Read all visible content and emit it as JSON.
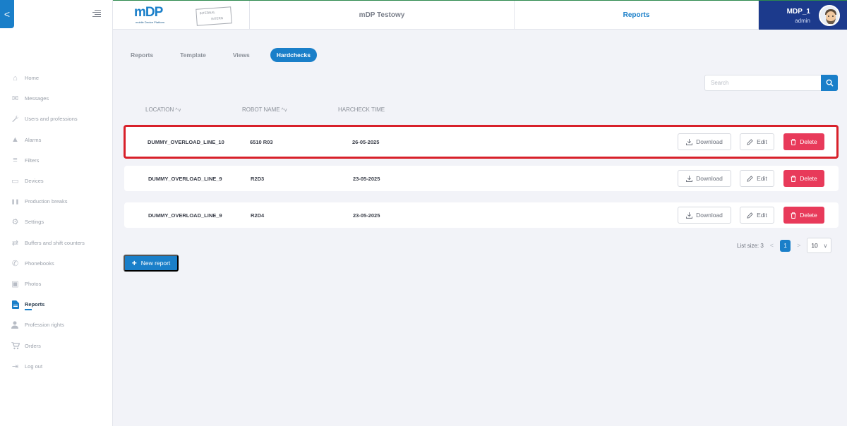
{
  "sidebar": {
    "collapse_glyph": "<",
    "items": [
      {
        "label": "Home",
        "icon": "home-icon",
        "glyph": "⌂"
      },
      {
        "label": "Messages",
        "icon": "mail-icon",
        "glyph": "✉"
      },
      {
        "label": "Users and professions",
        "icon": "wrench-icon",
        "glyph": "🔧"
      },
      {
        "label": "Alarms",
        "icon": "warning-icon",
        "glyph": "▲"
      },
      {
        "label": "Filters",
        "icon": "filter-icon",
        "glyph": "≡"
      },
      {
        "label": "Devices",
        "icon": "devices-icon",
        "glyph": "▭"
      },
      {
        "label": "Production breaks",
        "icon": "pause-icon",
        "glyph": "❚❚"
      },
      {
        "label": "Settings",
        "icon": "gear-icon",
        "glyph": "⚙"
      },
      {
        "label": "Buffers and shift counters",
        "icon": "transfer-icon",
        "glyph": "⇄"
      },
      {
        "label": "Phonebooks",
        "icon": "phone-icon",
        "glyph": "✆"
      },
      {
        "label": "Photos",
        "icon": "image-icon",
        "glyph": "▣"
      },
      {
        "label": "Reports",
        "icon": "document-icon",
        "glyph": "▤",
        "active": true
      },
      {
        "label": "Profession rights",
        "icon": "user-key-icon",
        "glyph": "👤"
      },
      {
        "label": "Orders",
        "icon": "cart-icon",
        "glyph": "🛒"
      },
      {
        "label": "Log out",
        "icon": "logout-icon",
        "glyph": "⇥"
      }
    ]
  },
  "header": {
    "logo_text": "mDP",
    "logo_subtitle": "mobile Device Platform",
    "stamp_line1": "INTERNAL",
    "stamp_line2": "INTERN",
    "app_name": "mDP Testowy",
    "section": "Reports",
    "user_name": "MDP_1",
    "user_role": "admin"
  },
  "tabs": [
    {
      "label": "Reports",
      "active": false
    },
    {
      "label": "Template",
      "active": false
    },
    {
      "label": "Views",
      "active": false
    },
    {
      "label": "Hardchecks",
      "active": true
    }
  ],
  "search": {
    "placeholder": "Search",
    "value": ""
  },
  "table": {
    "columns": [
      {
        "label": "LOCATION",
        "sortable": true,
        "sort_glyph": "^v"
      },
      {
        "label": "ROBOT NAME",
        "sortable": true,
        "sort_glyph": "^v"
      },
      {
        "label": "HARCHECK TIME",
        "sortable": false
      }
    ],
    "rows": [
      {
        "location": "DUMMY_OVERLOAD_LINE_10",
        "robot": "6510 R03",
        "time": "26-05-2025",
        "highlighted": true
      },
      {
        "location": "DUMMY_OVERLOAD_LINE_9",
        "robot": "R2D3",
        "time": "23-05-2025",
        "highlighted": false
      },
      {
        "location": "DUMMY_OVERLOAD_LINE_9",
        "robot": "R2D4",
        "time": "23-05-2025",
        "highlighted": false
      }
    ],
    "actions": {
      "download": "Download",
      "edit": "Edit",
      "delete": "Delete"
    }
  },
  "pagination": {
    "list_size_label": "List size: 3",
    "prev_glyph": "<",
    "next_glyph": ">",
    "current_page": "1",
    "page_size": "10",
    "page_size_chevron": "∨"
  },
  "new_report": {
    "plus": "+",
    "label": "New report"
  },
  "colors": {
    "accent": "#1a7fc9",
    "danger": "#e83a5a",
    "user_panel": "#1c3a8c",
    "highlight_border": "#d8202a"
  }
}
